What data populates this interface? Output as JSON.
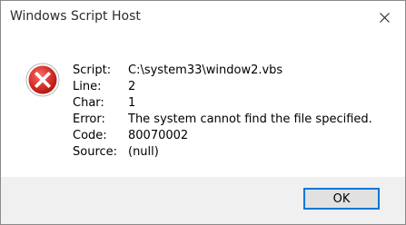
{
  "window": {
    "title": "Windows Script Host"
  },
  "icons": {
    "error": "error-icon",
    "close": "close-icon"
  },
  "details": {
    "script_label": "Script:",
    "script_value": "C:\\system33\\window2.vbs",
    "line_label": "Line:",
    "line_value": "2",
    "char_label": "Char:",
    "char_value": "1",
    "error_label": "Error:",
    "error_value": "The system cannot find the file specified.",
    "code_label": "Code:",
    "code_value": "80070002",
    "source_label": "Source:",
    "source_value": "(null)"
  },
  "footer": {
    "ok_label": "OK"
  },
  "colors": {
    "error_red": "#d9332b",
    "accent": "#0078d7",
    "footer_bg": "#f0f0f0"
  }
}
